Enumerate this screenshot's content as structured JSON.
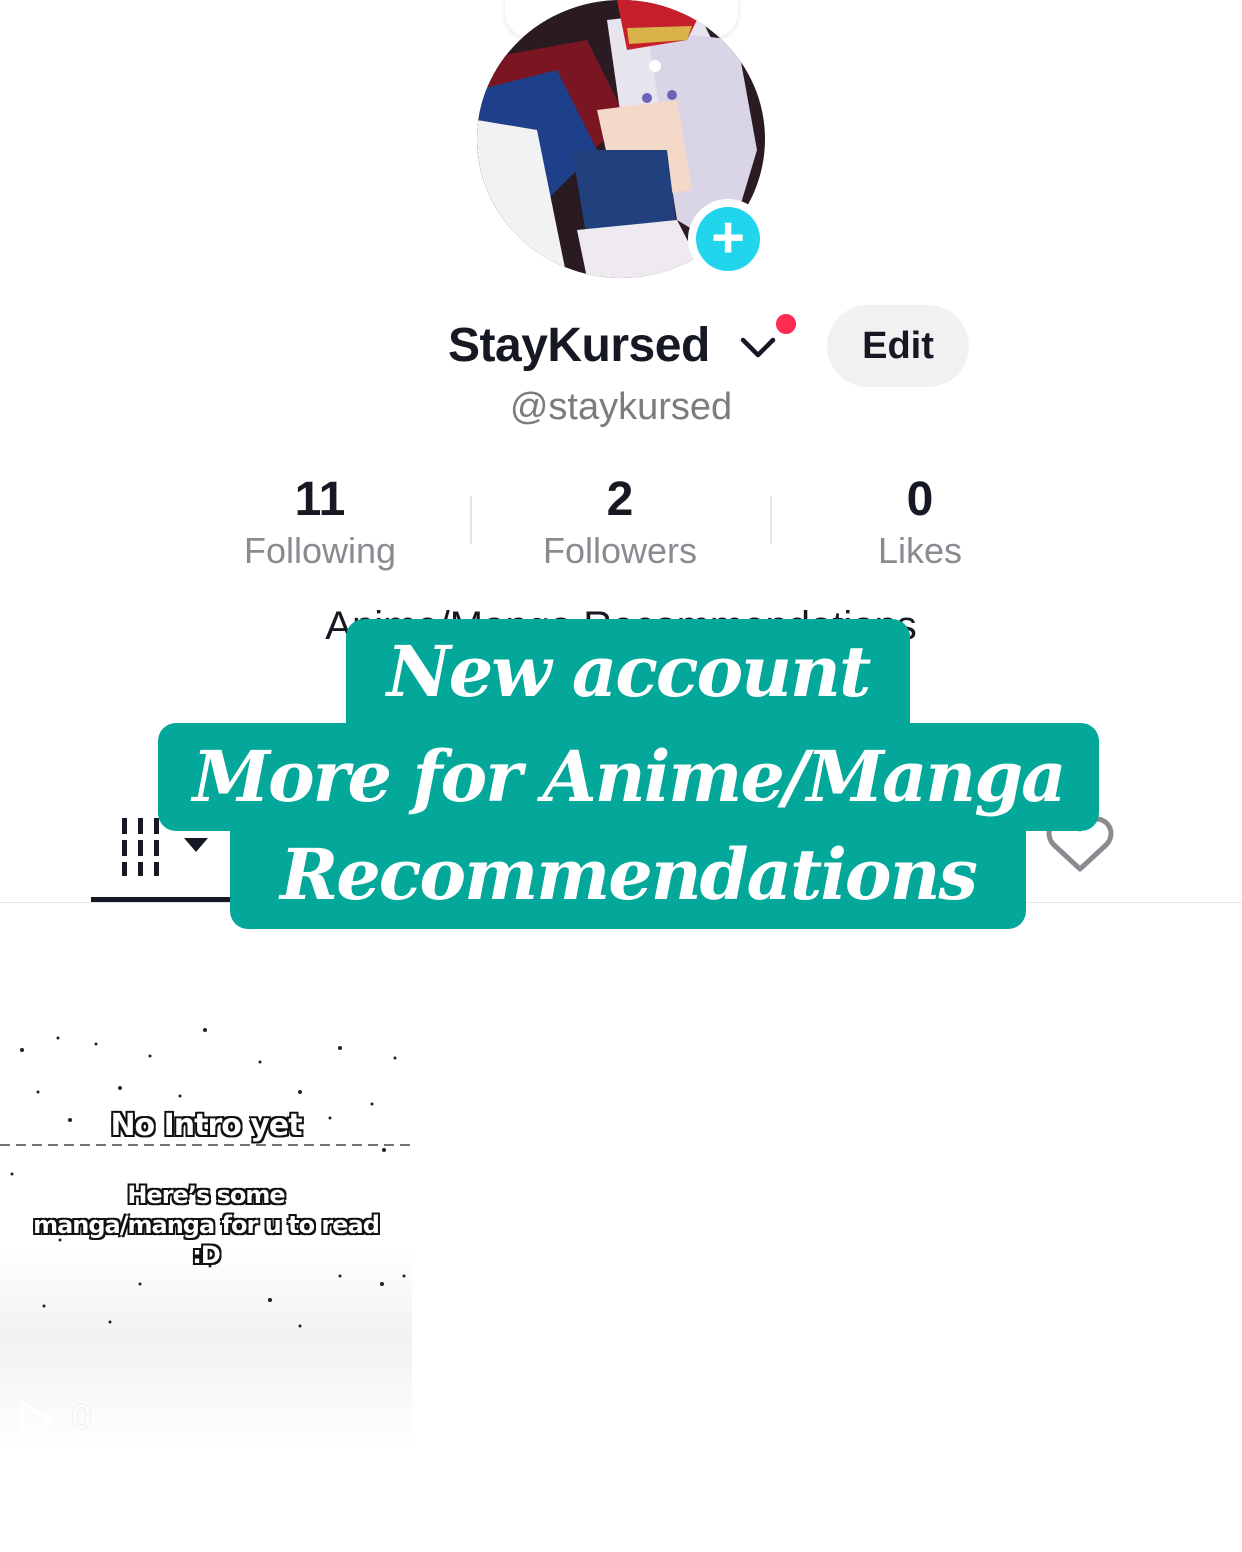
{
  "profile": {
    "display_name": "StayKursed",
    "handle": "@staykursed",
    "bio": "Anime/Manga Recommendations",
    "edit_label": "Edit"
  },
  "stats": [
    {
      "value": "11",
      "label": "Following"
    },
    {
      "value": "2",
      "label": "Followers"
    },
    {
      "value": "0",
      "label": "Likes"
    }
  ],
  "caption_overlay": {
    "line1": "New account",
    "line2": "More for Anime/Manga",
    "line3": "Recommendations"
  },
  "tabs": {
    "icons": [
      "grid-icon",
      "heart-icon"
    ]
  },
  "video": {
    "title": "No Intro yet",
    "body_line1": "Here’s some",
    "body_line2": "manga/manga for u to read",
    "body_line3": ":D",
    "views": "0"
  },
  "colors": {
    "caption_bg": "#03a89b",
    "accent_add": "#20d5ec",
    "notification_dot": "#fe2c55"
  }
}
